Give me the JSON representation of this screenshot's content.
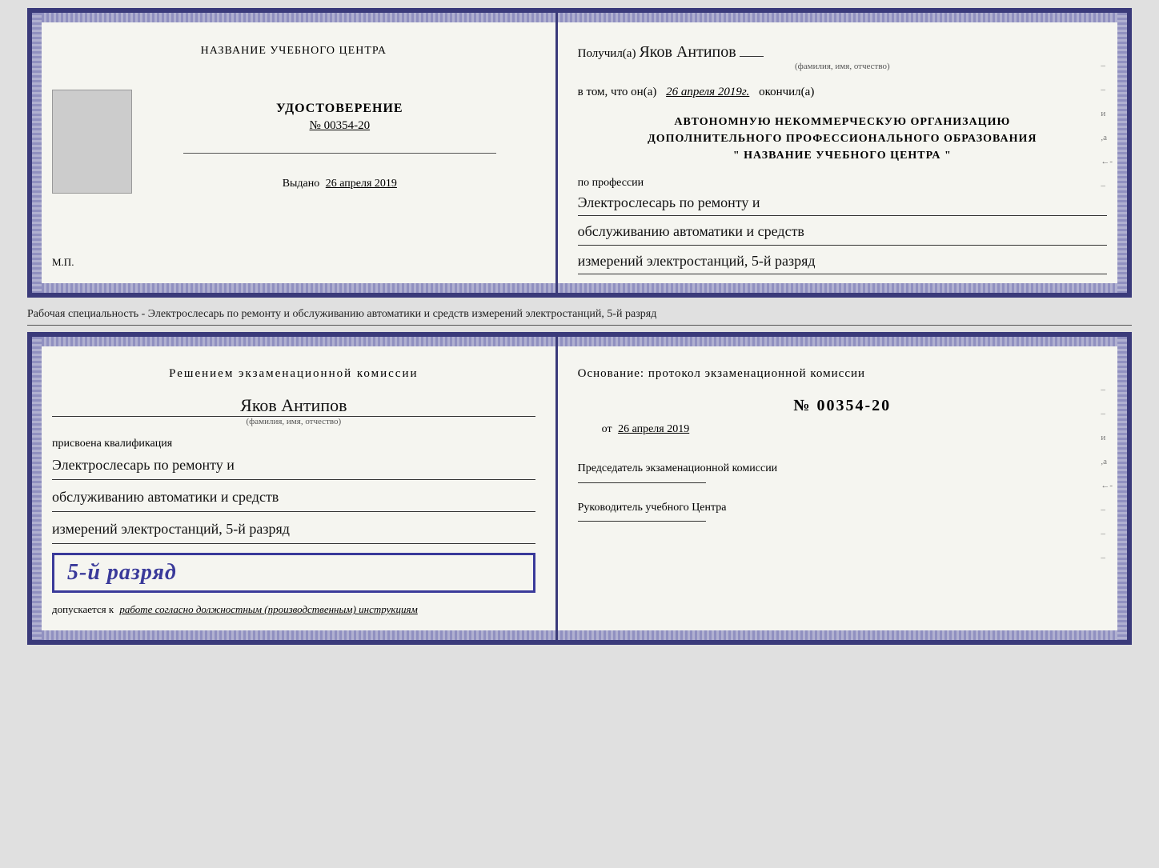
{
  "topLeft": {
    "schoolName": "НАЗВАНИЕ УЧЕБНОГО ЦЕНТРА",
    "certTitle": "УДОСТОВЕРЕНИЕ",
    "certNumber": "№ 00354-20",
    "issuedLabel": "Выдано",
    "issuedDate": "26 апреля 2019",
    "mpLabel": "М.П."
  },
  "topRight": {
    "receivedLabel": "Получил(а)",
    "recipientName": "Яков Антипов",
    "nameSubtext": "(фамилия, имя, отчество)",
    "dateLabel": "в том, что он(а)",
    "date": "26 апреля 2019г.",
    "finishedLabel": "окончил(а)",
    "orgLine1": "АВТОНОМНУЮ НЕКОММЕРЧЕСКУЮ ОРГАНИЗАЦИЮ",
    "orgLine2": "ДОПОЛНИТЕЛЬНОГО ПРОФЕССИОНАЛЬНОГО ОБРАЗОВАНИЯ",
    "orgLine3": "\"   НАЗВАНИЕ УЧЕБНОГО ЦЕНТРА   \"",
    "professionLabel": "по профессии",
    "profession1": "Электрослесарь по ремонту и",
    "profession2": "обслуживанию автоматики и средств",
    "profession3": "измерений электростанций, 5-й разряд"
  },
  "middleStrip": {
    "text": "Рабочая специальность - Электрослесарь по ремонту и обслуживанию автоматики и средств измерений электростанций, 5-й разряд"
  },
  "bottomLeft": {
    "decisionTitle": "Решением экзаменационной комиссии",
    "personName": "Яков Антипов",
    "nameSubtext": "(фамилия, имя, отчество)",
    "assignedLabel": "присвоена квалификация",
    "qual1": "Электрослесарь по ремонту и",
    "qual2": "обслуживанию автоматики и средств",
    "qual3": "измерений электростанций, 5-й разряд",
    "gradeBadge": "5-й разряд",
    "allowedLabel": "допускается к",
    "allowedText": "работе согласно должностным (производственным) инструкциям"
  },
  "bottomRight": {
    "basisLabel": "Основание: протокол экзаменационной комиссии",
    "protocolNumber": "№ 00354-20",
    "fromLabel": "от",
    "fromDate": "26 апреля 2019",
    "chairmanLabel": "Председатель экзаменационной комиссии",
    "headLabel": "Руководитель учебного Центра"
  }
}
